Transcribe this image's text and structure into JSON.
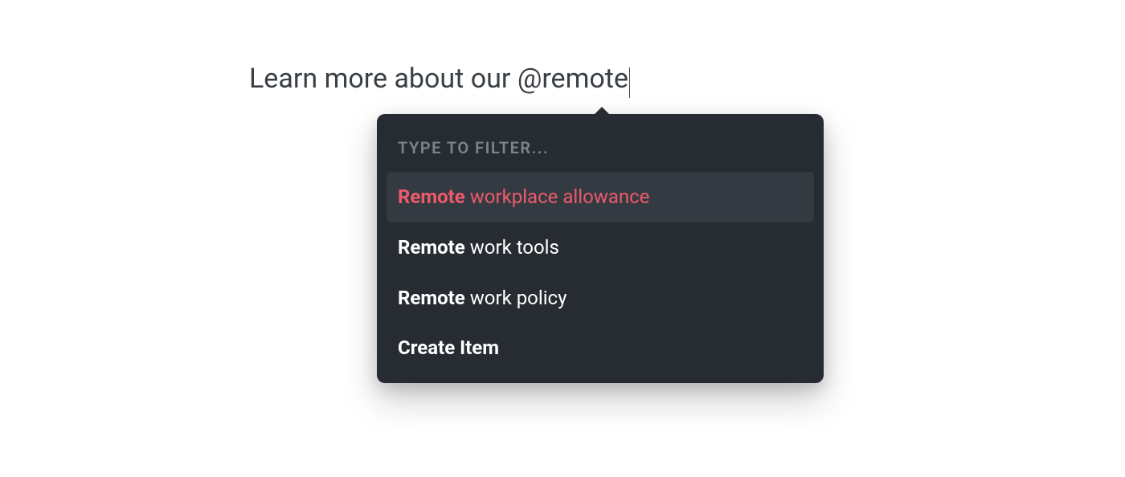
{
  "input": {
    "prefix": "Learn more about our ",
    "mention": "@remote"
  },
  "popup": {
    "header": "TYPE TO FILTER...",
    "items": [
      {
        "match": "Remote",
        "rest": " workplace allowance",
        "selected": true
      },
      {
        "match": "Remote",
        "rest": " work tools",
        "selected": false
      },
      {
        "match": "Remote",
        "rest": " work policy",
        "selected": false
      }
    ],
    "createLabel": "Create Item"
  }
}
